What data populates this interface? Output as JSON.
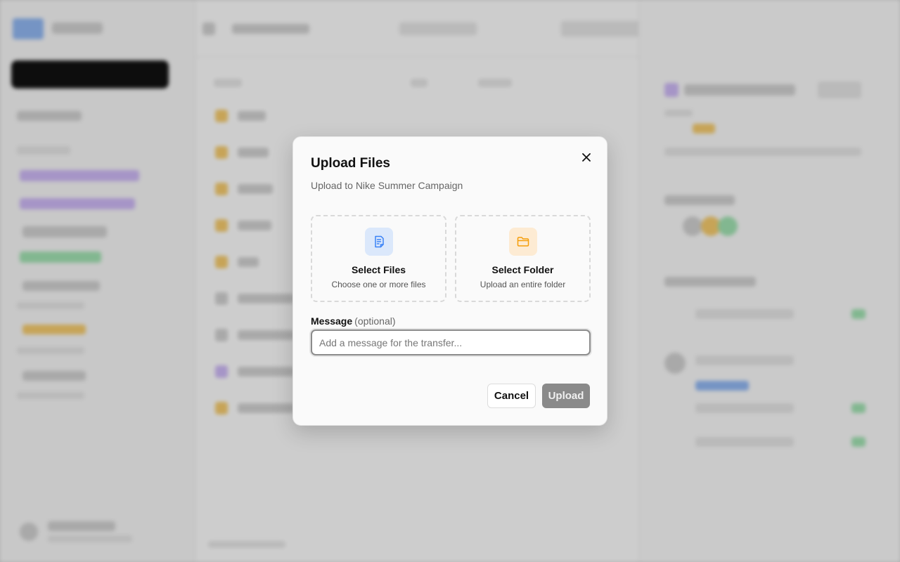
{
  "dialog": {
    "title": "Upload Files",
    "subtitle": "Upload to Nike Summer Campaign",
    "close_icon": "close-icon",
    "select_files": {
      "icon": "file-icon",
      "title": "Select Files",
      "description": "Choose one or more files",
      "accent": "#3b82f6"
    },
    "select_folder": {
      "icon": "folder-icon",
      "title": "Select Folder",
      "description": "Upload an entire folder",
      "accent": "#f59e0b"
    },
    "message": {
      "label": "Message",
      "optional": "(optional)",
      "placeholder": "Add a message for the transfer...",
      "value": ""
    },
    "cancel_label": "Cancel",
    "upload_label": "Upload"
  }
}
